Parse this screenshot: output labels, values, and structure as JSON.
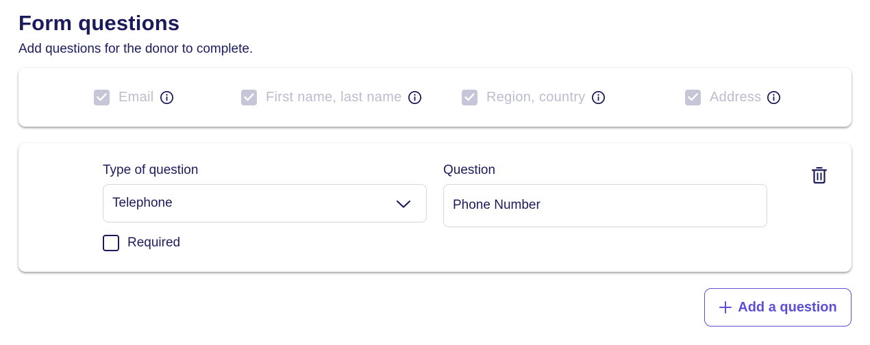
{
  "header": {
    "title": "Form questions",
    "subtitle": "Add questions for the donor to complete."
  },
  "default_fields": [
    {
      "label": "Email",
      "checked": true,
      "disabled": true,
      "icon": "info-icon"
    },
    {
      "label": "First name, last name",
      "checked": true,
      "disabled": true,
      "icon": "info-icon"
    },
    {
      "label": "Region, country",
      "checked": true,
      "disabled": true,
      "icon": "info-icon"
    },
    {
      "label": "Address",
      "checked": true,
      "disabled": true,
      "icon": "info-icon"
    }
  ],
  "question": {
    "type_label": "Type of question",
    "type_value": "Telephone",
    "question_label": "Question",
    "question_value": "Phone Number",
    "required_label": "Required",
    "required_checked": false,
    "delete_icon": "trash-icon"
  },
  "actions": {
    "add_label": "Add a question",
    "add_icon": "plus-icon"
  },
  "colors": {
    "primary_text": "#1b1b5c",
    "accent": "#5a4fd6",
    "disabled_text": "#bcbccf",
    "disabled_checkbox": "#c6c6d9",
    "border": "#d6d6e0"
  }
}
